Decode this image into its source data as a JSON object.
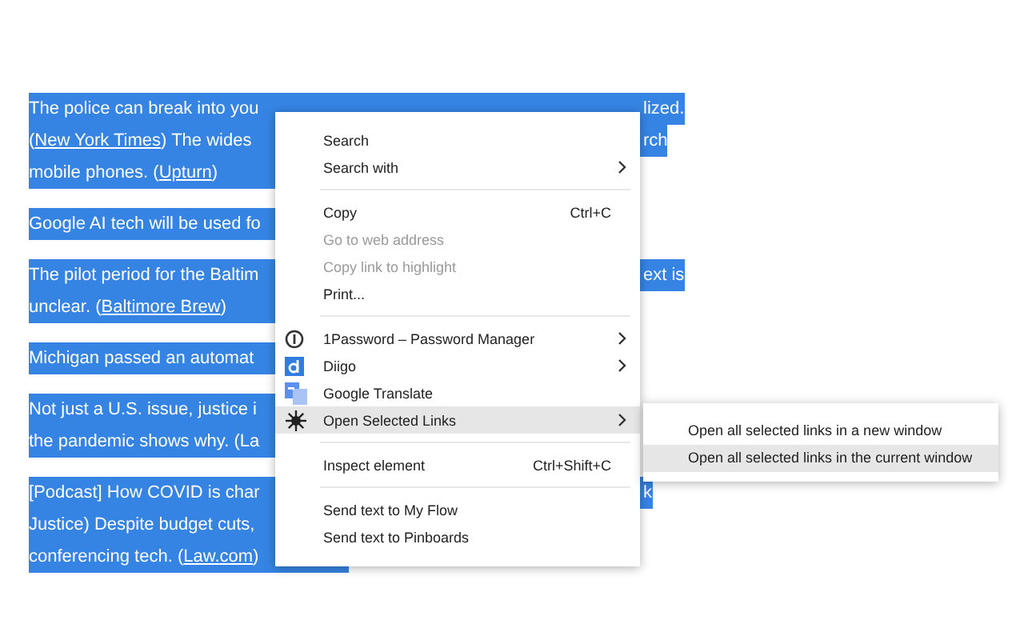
{
  "page": {
    "paragraphs": [
      {
        "lines": [
          {
            "segments": [
              {
                "text": "The police can break into you",
                "link": false
              }
            ],
            "right": "lized."
          },
          {
            "segments": [
              {
                "text": "(",
                "link": false
              },
              {
                "text": "New York Times",
                "link": true
              },
              {
                "text": ") The wides",
                "link": false
              }
            ],
            "right": "rch"
          },
          {
            "segments": [
              {
                "text": "mobile phones. (",
                "link": false
              },
              {
                "text": "Upturn",
                "link": true
              },
              {
                "text": ")",
                "link": false
              }
            ]
          }
        ]
      },
      {
        "lines": [
          {
            "segments": [
              {
                "text": "Google AI tech will be used fo",
                "link": false
              }
            ]
          }
        ]
      },
      {
        "lines": [
          {
            "segments": [
              {
                "text": "The pilot period for the Baltim",
                "link": false
              }
            ],
            "right": "ext is"
          },
          {
            "segments": [
              {
                "text": "unclear. (",
                "link": false
              },
              {
                "text": "Baltimore Brew",
                "link": true
              },
              {
                "text": ")",
                "link": false
              }
            ]
          }
        ]
      },
      {
        "lines": [
          {
            "segments": [
              {
                "text": "Michigan passed an automat",
                "link": false
              }
            ]
          }
        ]
      },
      {
        "lines": [
          {
            "segments": [
              {
                "text": "Not just a U.S. issue, justice i",
                "link": false
              }
            ]
          },
          {
            "segments": [
              {
                "text": "the pandemic shows why. (La",
                "link": false
              }
            ]
          }
        ]
      },
      {
        "lines": [
          {
            "segments": [
              {
                "text": "[Podcast] How COVID is char",
                "link": false
              }
            ],
            "right": "k"
          },
          {
            "segments": [
              {
                "text": "Justice) Despite budget cuts,",
                "link": false
              }
            ]
          },
          {
            "segments": [
              {
                "text": "conferencing tech. (",
                "link": false
              },
              {
                "text": "Law.com",
                "link": true
              },
              {
                "text": ")",
                "link": false
              }
            ]
          }
        ]
      }
    ]
  },
  "context_menu": {
    "groups": [
      [
        {
          "label": "Search",
          "kind": "plain",
          "disabled": false,
          "submenu": false,
          "selected": false
        },
        {
          "label": "Search with",
          "kind": "plain",
          "disabled": false,
          "submenu": true,
          "selected": false
        }
      ],
      [
        {
          "label": "Copy",
          "kind": "plain",
          "shortcut": "Ctrl+C",
          "disabled": false,
          "submenu": false,
          "selected": false
        },
        {
          "label": "Go to web address",
          "kind": "plain",
          "disabled": true,
          "submenu": false,
          "selected": false
        },
        {
          "label": "Copy link to highlight",
          "kind": "plain",
          "disabled": true,
          "submenu": false,
          "selected": false
        },
        {
          "label": "Print...",
          "kind": "plain",
          "disabled": false,
          "submenu": false,
          "selected": false
        }
      ],
      [
        {
          "label": "1Password – Password Manager",
          "kind": "password",
          "disabled": false,
          "submenu": true,
          "selected": false
        },
        {
          "label": "Diigo",
          "kind": "diigo",
          "disabled": false,
          "submenu": true,
          "selected": false
        },
        {
          "label": "Google Translate",
          "kind": "translate",
          "disabled": false,
          "submenu": false,
          "selected": false
        },
        {
          "label": "Open Selected Links",
          "kind": "sun",
          "disabled": false,
          "submenu": true,
          "selected": true
        }
      ],
      [
        {
          "label": "Inspect element",
          "kind": "plain",
          "shortcut": "Ctrl+Shift+C",
          "disabled": false,
          "submenu": false,
          "selected": false
        }
      ],
      [
        {
          "label": "Send text to My Flow",
          "kind": "plain",
          "disabled": false,
          "submenu": false,
          "selected": false
        },
        {
          "label": "Send text to Pinboards",
          "kind": "plain",
          "disabled": false,
          "submenu": false,
          "selected": false
        }
      ]
    ]
  },
  "submenu": {
    "items": [
      {
        "label": "Open all selected links in a new window",
        "selected": false
      },
      {
        "label": "Open all selected links in the current window",
        "selected": true
      }
    ]
  }
}
